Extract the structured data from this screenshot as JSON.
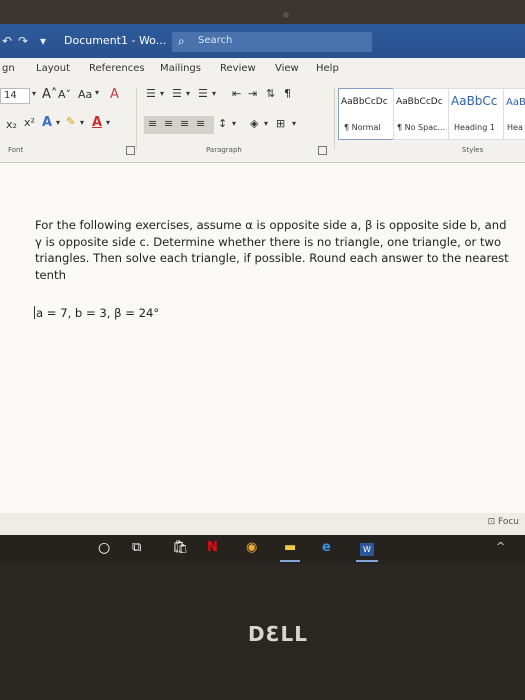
{
  "window": {
    "title": "Document1  -  Wo..."
  },
  "search": {
    "placeholder": "Search"
  },
  "tabs": [
    "gn",
    "Layout",
    "References",
    "Mailings",
    "Review",
    "View",
    "Help"
  ],
  "font_group": {
    "size": "14",
    "grow": "A˄",
    "shrink": "A˅",
    "change_case": "Aa",
    "clear": "A",
    "sub": "x₂",
    "sup": "x²",
    "label": "Font"
  },
  "paragraph_group": {
    "label": "Paragraph"
  },
  "styles_group": {
    "label": "Styles",
    "items": [
      {
        "sample": "AaBbCcDc",
        "name": "¶ Normal"
      },
      {
        "sample": "AaBbCcDc",
        "name": "¶ No Spac..."
      },
      {
        "sample": "AaBbCc",
        "name": "Heading 1"
      },
      {
        "sample": "AaB",
        "name": "Hea"
      }
    ]
  },
  "document": {
    "paragraph": "For the following exercises, assume α is opposite side a, β is opposite side b, and γ is opposite side c. Determine whether there is no triangle, one triangle, or two triangles. Then solve each triangle, if possible. Round each answer to the nearest tenth",
    "equation": "a = 7, b = 3, β = 24°"
  },
  "status": {
    "focus": "Focu"
  },
  "taskbar": [
    "cortana-circle",
    "task-view",
    "store",
    "netflix",
    "chrome",
    "file-explorer",
    "edge",
    "word"
  ],
  "device": {
    "brand": "DƐLL"
  },
  "colors": {
    "titlebar": "#2b5797",
    "taskbar": "#26231f"
  }
}
